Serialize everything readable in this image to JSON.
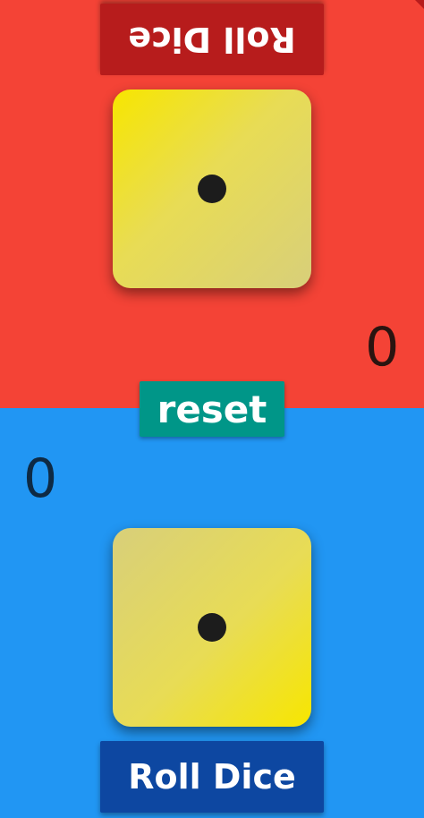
{
  "colors": {
    "top_bg": "#f44336",
    "bottom_bg": "#2196f3",
    "top_button": "#b71c1c",
    "bottom_button": "#0d47a1",
    "reset_button": "#009688",
    "die_face": "#ebe34a",
    "pip": "#1c1c1c"
  },
  "top_player": {
    "roll_label": "Roll Dice",
    "score": "0",
    "die_value": 1
  },
  "bottom_player": {
    "roll_label": "Roll Dice",
    "score": "0",
    "die_value": 1
  },
  "reset_label": "reset"
}
